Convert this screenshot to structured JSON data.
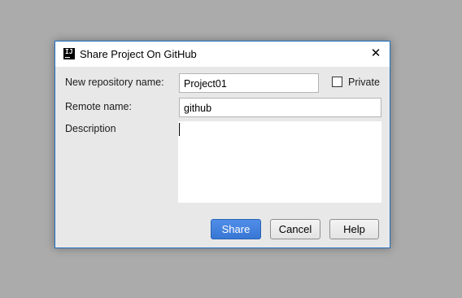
{
  "dialog": {
    "title": "Share Project On GitHub",
    "app_icon_text": "IJ",
    "close_symbol": "✕"
  },
  "form": {
    "repo_name_label": "New repository name:",
    "repo_name_value": "Project01",
    "private_label": "Private",
    "private_checked": false,
    "remote_name_label": "Remote name:",
    "remote_name_value": "github",
    "description_label": "Description",
    "description_value": ""
  },
  "buttons": {
    "share": "Share",
    "cancel": "Cancel",
    "help": "Help"
  },
  "colors": {
    "backdrop": "#ababab",
    "dialog_bg": "#e8e8e8",
    "dialog_border": "#1e6fbf",
    "primary_button": "#4185e0"
  },
  "icons": {
    "app": "intellij-icon",
    "close": "close-icon"
  }
}
